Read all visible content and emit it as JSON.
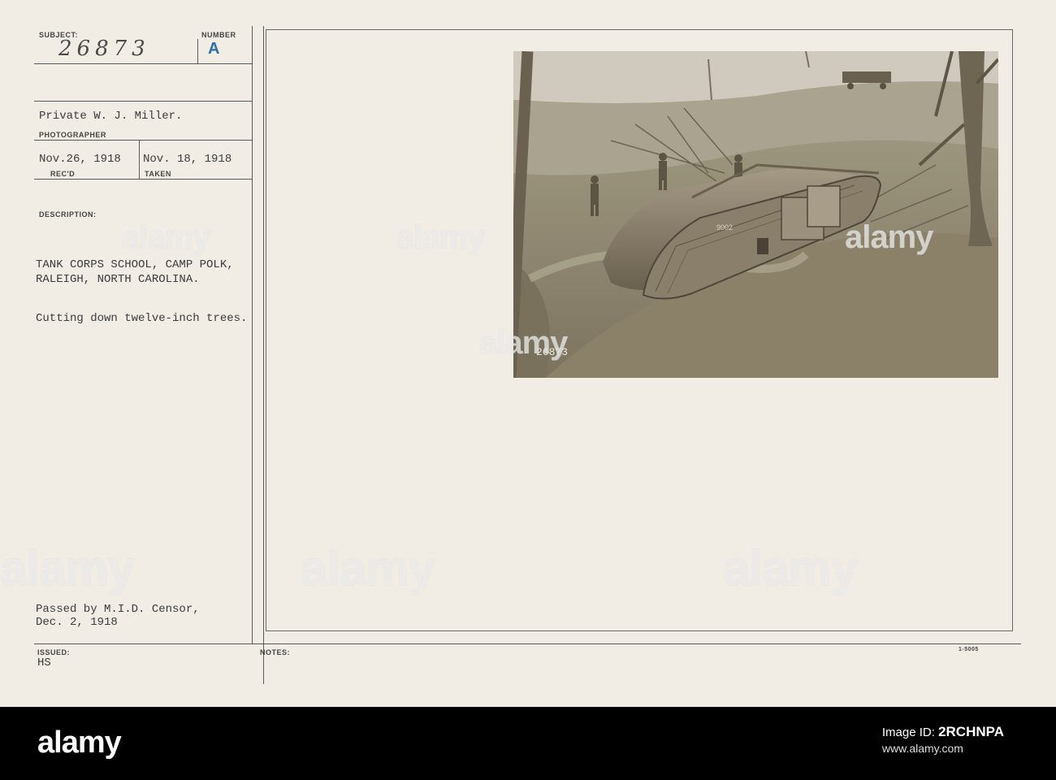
{
  "card": {
    "subject_label": "SUBJECT:",
    "subject_value": "26873",
    "number_label": "NUMBER",
    "number_value": "A",
    "photographer_name": "Private W. J. Miller.",
    "photographer_label": "PHOTOGRAPHER",
    "received_date": "Nov.26, 1918",
    "received_label": "REC'D",
    "taken_date": "Nov. 18, 1918",
    "taken_label": "TAKEN",
    "description_label": "DESCRIPTION:",
    "description_line1": "TANK CORPS SCHOOL, CAMP POLK,",
    "description_line2": "RALEIGH, NORTH CAROLINA.",
    "caption": "Cutting down twelve-inch trees.",
    "censor_line1": "Passed by M.I.D. Censor,",
    "censor_line2": "Dec. 2, 1918",
    "issued_label": "ISSUED:",
    "issued_value": "HS",
    "notes_label": "NOTES:",
    "form_number": "1-5005"
  },
  "photo": {
    "negative_number": "26873",
    "tank_number": "9002"
  },
  "watermark": {
    "text": "alamy"
  },
  "footer": {
    "logo": "alamy",
    "image_id_label": "Image ID:",
    "image_id": "2RCHNPA",
    "url": "www.alamy.com"
  }
}
